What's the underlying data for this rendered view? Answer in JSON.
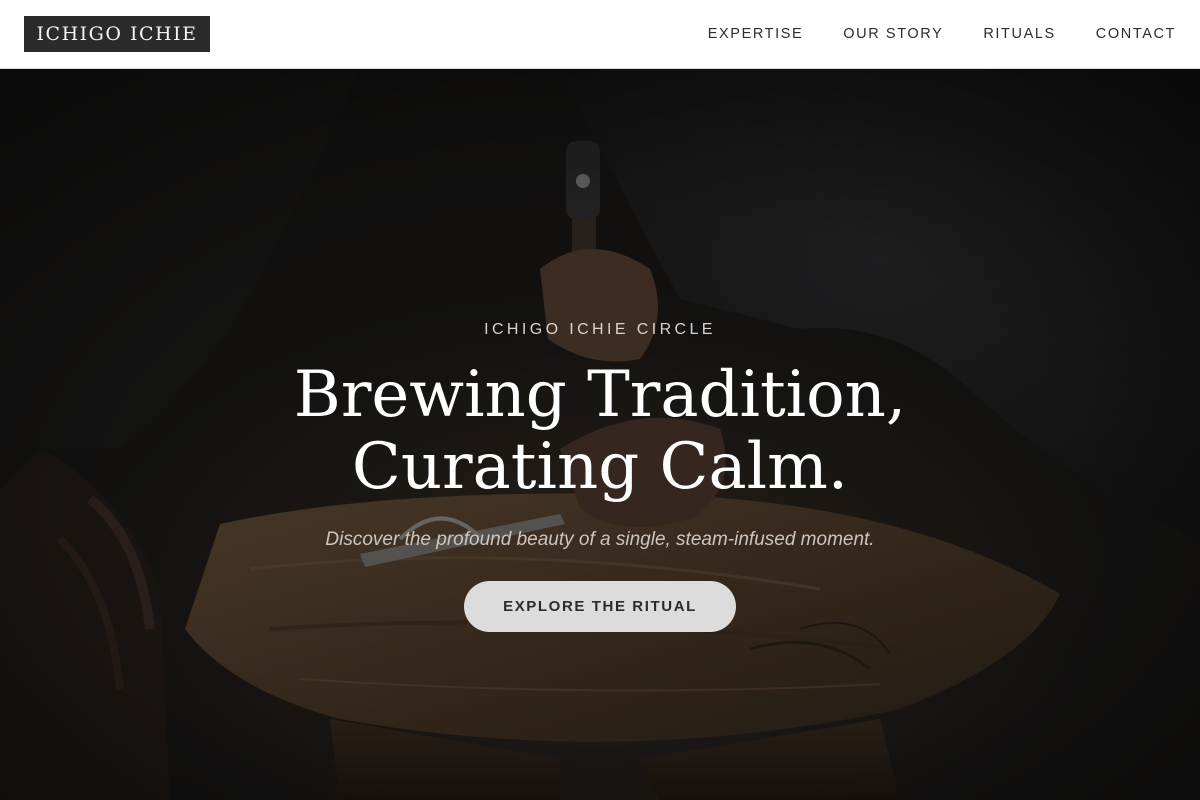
{
  "header": {
    "logo_text": "ICHIGO ICHIE",
    "nav": [
      {
        "label": "EXPERTISE"
      },
      {
        "label": "OUR STORY"
      },
      {
        "label": "RITUALS"
      },
      {
        "label": "CONTACT"
      }
    ]
  },
  "hero": {
    "eyebrow": "ICHIGO ICHIE CIRCLE",
    "headline_line1": "Brewing Tradition,",
    "headline_line2": "Curating Calm.",
    "subtitle": "Discover the profound beauty of a single, steam-infused moment.",
    "cta_label": "EXPLORE THE RITUAL",
    "background_image": "craftsman-workbench-photo"
  },
  "colors": {
    "header_bg": "#ffffff",
    "logo_bg": "#2b2b2b",
    "nav_text": "#2d2d2d",
    "headline": "#ffffff",
    "cta_bg": "#dcdcdc",
    "cta_text": "#2b2b2b"
  }
}
